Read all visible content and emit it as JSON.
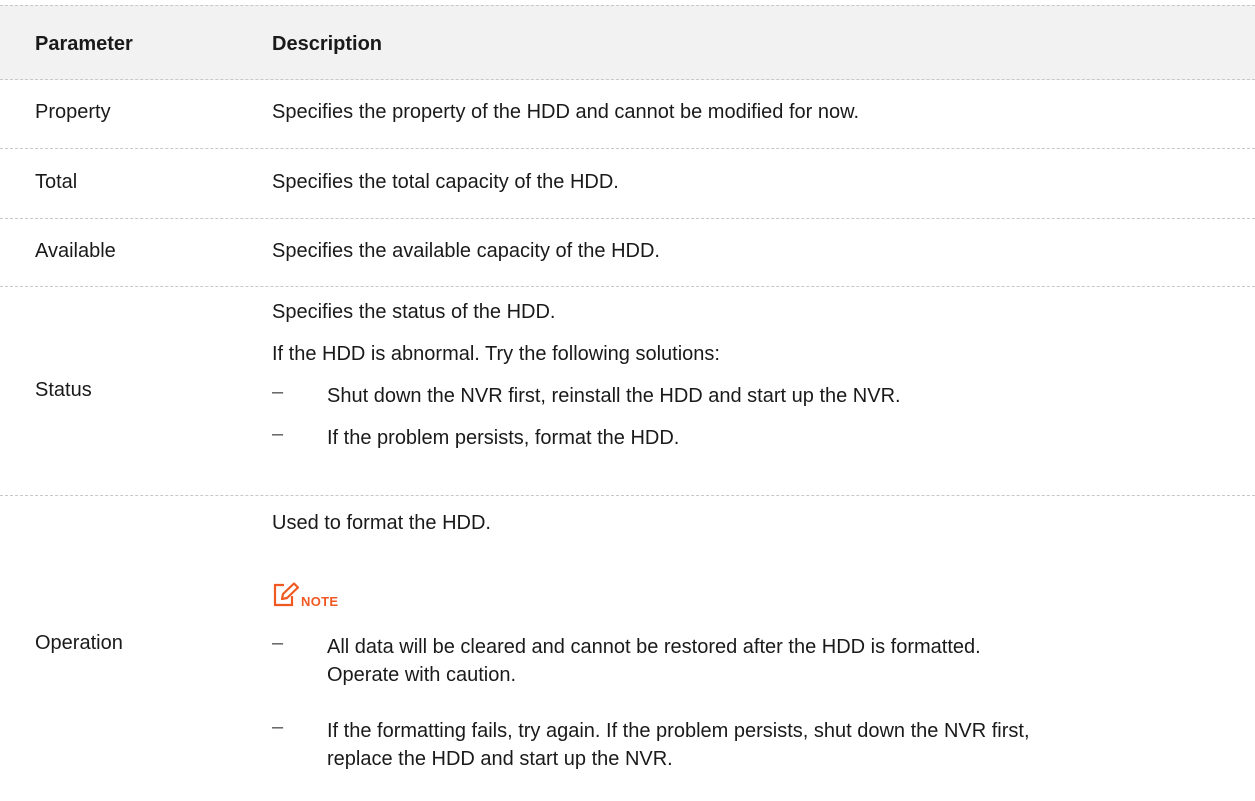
{
  "header": {
    "param": "Parameter",
    "desc": "Description"
  },
  "rows": {
    "property": {
      "param": "Property",
      "desc": "Specifies the property of the HDD and cannot be modified for now."
    },
    "total": {
      "param": "Total",
      "desc": "Specifies the total capacity of the HDD."
    },
    "available": {
      "param": "Available",
      "desc": "Specifies the available capacity of the HDD."
    },
    "status": {
      "param": "Status",
      "lines": [
        "Specifies the status of the HDD.",
        "If the HDD is abnormal. Try the following solutions:"
      ],
      "bullets": [
        "Shut down the NVR first, reinstall the HDD and start up the NVR.",
        "If the problem persists, format the HDD."
      ]
    },
    "operation": {
      "param": "Operation",
      "line": "Used to format the HDD.",
      "note_label": "NOTE",
      "bullets": [
        [
          "All data will be cleared and cannot be restored after the HDD is formatted.",
          "Operate with caution."
        ],
        [
          "If the formatting fails, try again. If the problem persists, shut down the NVR first,",
          "replace the HDD and start up the NVR."
        ]
      ]
    }
  },
  "colors": {
    "note_accent": "#f05a22",
    "header_bg": "#f2f2f2"
  },
  "icons": {
    "bullet": "–",
    "note": "note-edit-icon"
  }
}
